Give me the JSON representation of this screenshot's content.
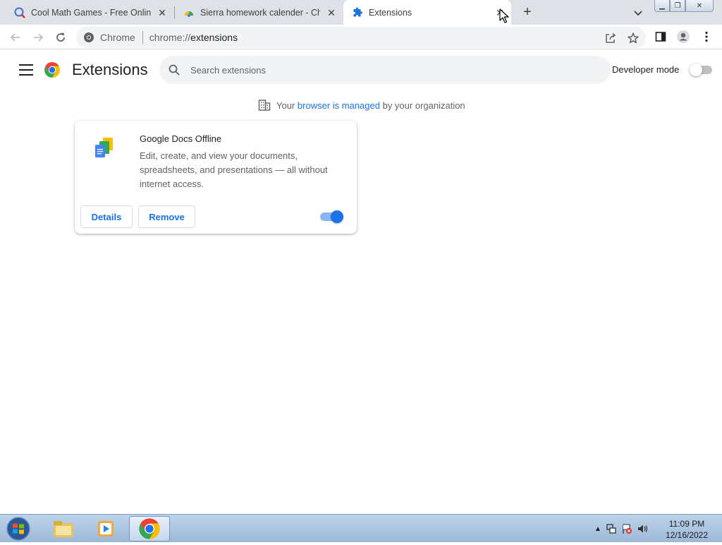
{
  "tabs": [
    {
      "title": "Cool Math Games - Free Online M",
      "icon": "coolmath-icon"
    },
    {
      "title": "Sierra homework calender - Chro",
      "icon": "chrome-web-store-icon"
    },
    {
      "title": "Extensions",
      "icon": "puzzle-icon",
      "active": true
    }
  ],
  "toolbar": {
    "site_chip": "Chrome",
    "url_scheme": "chrome://",
    "url_path": "extensions"
  },
  "header": {
    "title": "Extensions",
    "search_placeholder": "Search extensions",
    "developer_mode_label": "Developer mode",
    "developer_mode_on": false
  },
  "managed": {
    "prefix": "Your",
    "link": "browser is managed",
    "suffix": "by your organization"
  },
  "extensions": [
    {
      "name": "Google Docs Offline",
      "description": "Edit, create, and view your documents, spreadsheets, and presentations — all without internet access.",
      "details_label": "Details",
      "remove_label": "Remove",
      "enabled": true
    }
  ],
  "taskbar": {
    "time": "11:09 PM",
    "date": "12/16/2022"
  },
  "colors": {
    "accent": "#1a73e8",
    "tabstrip": "#dee1e6",
    "toggle_track_on": "#8ab4f8"
  }
}
